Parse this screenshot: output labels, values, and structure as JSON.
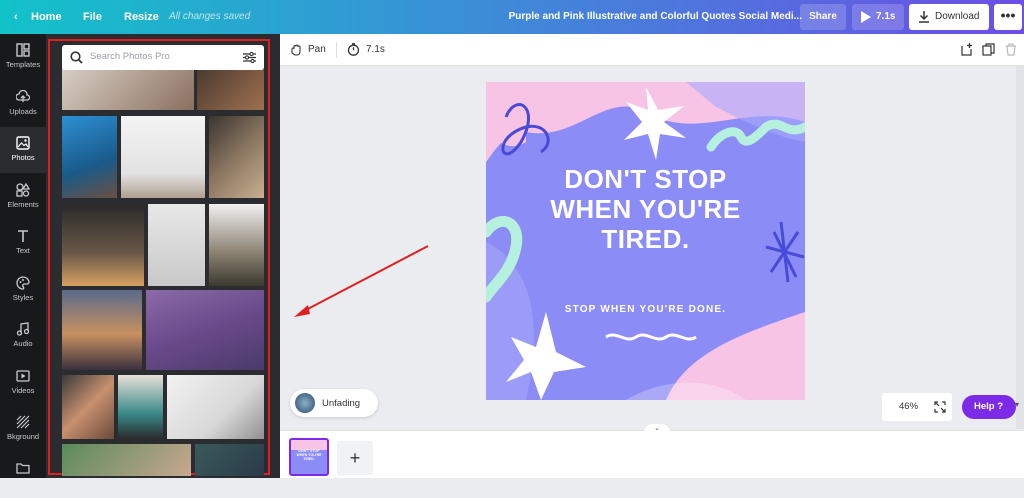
{
  "topbar": {
    "home_label": "Home",
    "file_label": "File",
    "resize_label": "Resize",
    "save_status": "All changes saved",
    "document_title": "Purple and Pink Illustrative and Colorful Quotes Social Medi...",
    "share_label": "Share",
    "play_duration": "7.1s",
    "download_label": "Download",
    "more_label": "•••"
  },
  "sidebar": {
    "items": [
      {
        "label": "Templates",
        "icon": "templates-icon"
      },
      {
        "label": "Uploads",
        "icon": "upload-icon"
      },
      {
        "label": "Photos",
        "icon": "photos-icon",
        "active": true
      },
      {
        "label": "Elements",
        "icon": "elements-icon"
      },
      {
        "label": "Text",
        "icon": "text-icon"
      },
      {
        "label": "Styles",
        "icon": "palette-icon"
      },
      {
        "label": "Audio",
        "icon": "music-icon"
      },
      {
        "label": "Videos",
        "icon": "video-icon"
      },
      {
        "label": "Bkground",
        "icon": "background-icon"
      }
    ]
  },
  "photos_panel": {
    "search_placeholder": "Search Photos Pro"
  },
  "canvas_toolbar": {
    "pan_label": "Pan",
    "duration": "7.1s"
  },
  "design": {
    "quote": "DON'T STOP WHEN YOU'RE TIRED.",
    "quote_lines": [
      "DON'T STOP",
      "WHEN YOU'RE",
      "TIRED."
    ],
    "subtext": "STOP WHEN YOU'RE DONE.",
    "colors": {
      "background": "#8c8cf6",
      "pink": "#f7c4e6",
      "mint": "#b6f0de",
      "accent_blue": "#4a4ad8"
    }
  },
  "audio_track": {
    "label": "Unfading"
  },
  "zoom": {
    "level": "46%"
  },
  "help": {
    "label": "Help ?"
  },
  "thumbnail": {
    "caption": "DON'T STOP WHEN YOU'RE TIRED."
  },
  "add_page": {
    "label": "+"
  },
  "theme": {
    "accent": "#7d2ae8",
    "highlight_red": "#e02020",
    "rail_bg": "#18191b",
    "panel_bg": "#2b2c2f"
  }
}
